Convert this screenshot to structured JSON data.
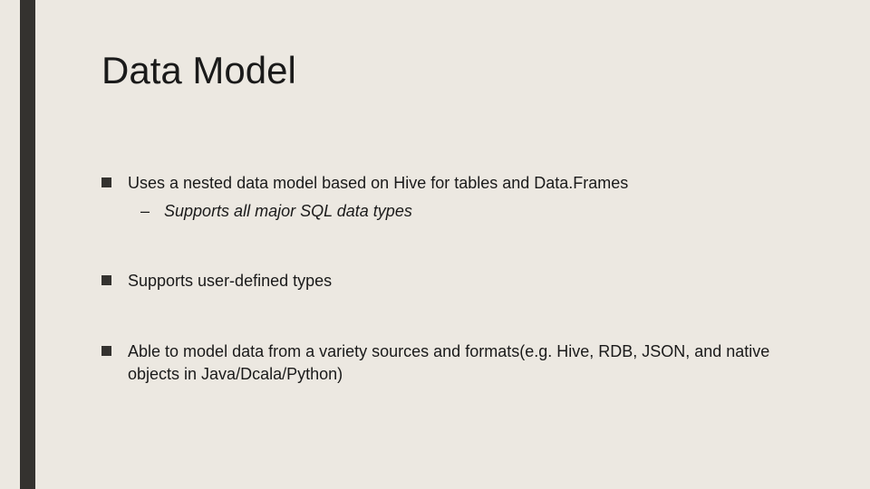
{
  "slide": {
    "title": "Data Model",
    "bullets": [
      {
        "text": "Uses a nested data model based on Hive for tables and Data.Frames",
        "subitems": [
          {
            "text": "Supports all major SQL data types"
          }
        ]
      },
      {
        "text": "Supports user-defined types",
        "subitems": []
      },
      {
        "text": "Able to model data from a variety sources and formats(e.g. Hive, RDB, JSON, and native objects in Java/Dcala/Python)",
        "subitems": []
      }
    ]
  }
}
